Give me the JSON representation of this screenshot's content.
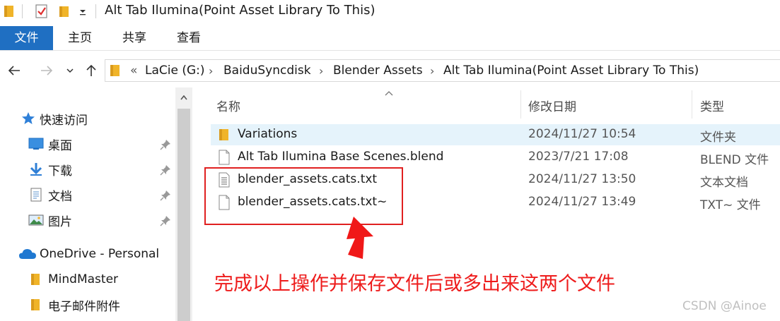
{
  "window": {
    "title": "Alt Tab Ilumina(Point Asset Library To This)"
  },
  "ribbon": {
    "tabs": [
      "文件",
      "主页",
      "共享",
      "查看"
    ]
  },
  "address": {
    "overflow": "«",
    "crumbs": [
      "LaCie (G:)",
      "BaiduSyncdisk",
      "Blender Assets",
      "Alt Tab Ilumina(Point Asset Library To This)"
    ]
  },
  "nav": {
    "quick_access": "快速访问",
    "desktop": "桌面",
    "downloads": "下载",
    "documents": "文档",
    "pictures": "图片",
    "onedrive": "OneDrive - Personal",
    "mindmaster": "MindMaster",
    "email_attachments": "电子邮件附件"
  },
  "columns": {
    "name": "名称",
    "date": "修改日期",
    "type": "类型"
  },
  "files": [
    {
      "name": "Variations",
      "date": "2024/11/27 10:54",
      "type": "文件夹",
      "icon": "folder-icon"
    },
    {
      "name": "Alt Tab Ilumina Base Scenes.blend",
      "date": "2023/7/21 17:08",
      "type": "BLEND 文件",
      "icon": "file-icon"
    },
    {
      "name": "blender_assets.cats.txt",
      "date": "2024/11/27 13:50",
      "type": "文本文档",
      "icon": "text-file-icon"
    },
    {
      "name": "blender_assets.cats.txt~",
      "date": "2024/11/27 13:49",
      "type": "TXT~ 文件",
      "icon": "file-icon"
    }
  ],
  "annotation": {
    "note": "完成以上操作并保存文件后或多出来这两个文件"
  },
  "watermark": "CSDN @Ainoe",
  "colors": {
    "accent": "#1f6fc2",
    "selection": "#e5f3fb",
    "annotation_red": "#e02020",
    "folder": "#f5c342"
  }
}
